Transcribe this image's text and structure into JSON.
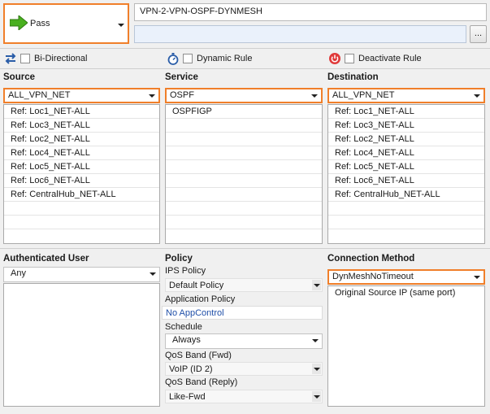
{
  "action": {
    "label": "Pass",
    "icon": "green-arrow-right-icon"
  },
  "rule": {
    "name": "VPN-2-VPN-OSPF-DYNMESH",
    "comment": "",
    "more_label": "..."
  },
  "options": {
    "bidirectional": {
      "label": "Bi-Directional",
      "icon": "bidirectional-arrows-icon",
      "checked": false
    },
    "dynamic_rule": {
      "label": "Dynamic Rule",
      "icon": "stopwatch-icon",
      "checked": false
    },
    "deactivate_rule": {
      "label": "Deactivate Rule",
      "icon": "power-icon",
      "checked": false
    }
  },
  "source": {
    "label": "Source",
    "selected": "ALL_VPN_NET",
    "items": [
      "Ref: Loc1_NET-ALL",
      "Ref: Loc3_NET-ALL",
      "Ref: Loc2_NET-ALL",
      "Ref: Loc4_NET-ALL",
      "Ref: Loc5_NET-ALL",
      "Ref: Loc6_NET-ALL",
      "Ref: CentralHub_NET-ALL"
    ]
  },
  "service": {
    "label": "Service",
    "selected": "OSPF",
    "items": [
      "OSPFIGP"
    ]
  },
  "destination": {
    "label": "Destination",
    "selected": "ALL_VPN_NET",
    "items": [
      "Ref: Loc1_NET-ALL",
      "Ref: Loc3_NET-ALL",
      "Ref: Loc2_NET-ALL",
      "Ref: Loc4_NET-ALL",
      "Ref: Loc5_NET-ALL",
      "Ref: Loc6_NET-ALL",
      "Ref: CentralHub_NET-ALL"
    ]
  },
  "auth_user": {
    "label": "Authenticated User",
    "selected": "Any"
  },
  "policy": {
    "label": "Policy",
    "ips_label": "IPS Policy",
    "ips_value": "Default Policy",
    "app_label": "Application Policy",
    "app_value": "No AppControl",
    "schedule_label": "Schedule",
    "schedule_value": "Always",
    "qos_fwd_label": "QoS Band (Fwd)",
    "qos_fwd_value": "VoIP (ID 2)",
    "qos_reply_label": "QoS Band (Reply)",
    "qos_reply_value": "Like-Fwd"
  },
  "connection": {
    "label": "Connection Method",
    "selected": "DynMeshNoTimeout",
    "items": [
      "Original Source IP (same port)"
    ]
  },
  "colors": {
    "accent": "#f07f2a",
    "link": "#1f4fa8",
    "pass_green": "#49b01f"
  }
}
